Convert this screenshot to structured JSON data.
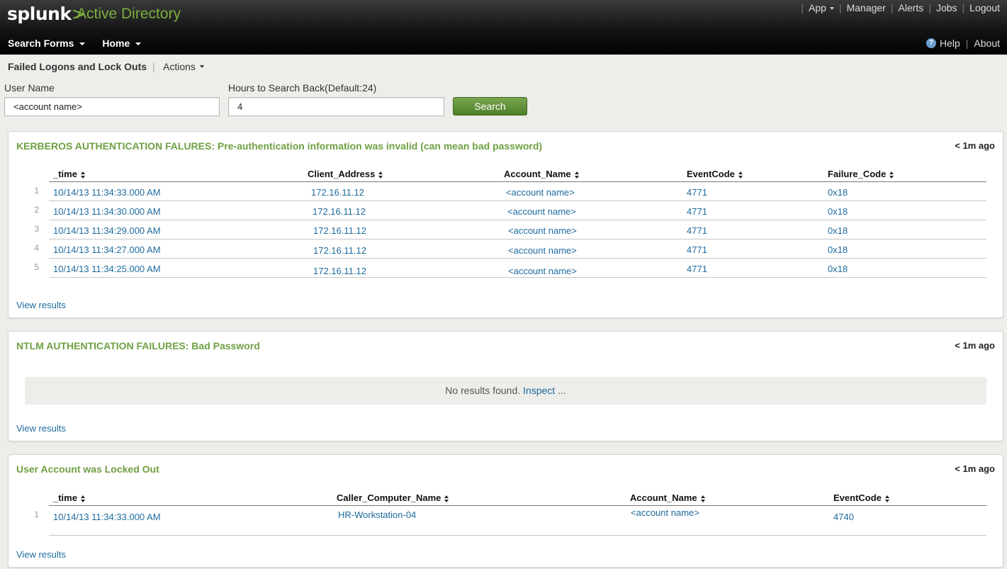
{
  "header": {
    "logo_text": "splunk",
    "logo_mark": ">",
    "app_name": "Active Directory",
    "top_links": [
      "App",
      "Manager",
      "Alerts",
      "Jobs",
      "Logout"
    ],
    "nav": [
      {
        "label": "Search Forms"
      },
      {
        "label": "Home"
      }
    ],
    "help_label": "Help",
    "about_label": "About"
  },
  "view": {
    "title": "Failed Logons and Lock Outs",
    "separator": "|",
    "actions_label": "Actions"
  },
  "form": {
    "user_label": "User Name",
    "user_value": "<account name>",
    "hours_label": "Hours to Search Back(Default:24)",
    "hours_value": "4",
    "search_label": "Search"
  },
  "panels": {
    "kerberos": {
      "title": "KERBEROS AUTHENTICATION FALURES: Pre-authentication information was invalid (can mean bad password)",
      "age": "< 1m ago",
      "columns": [
        "_time",
        "Client_Address",
        "Account_Name",
        "EventCode",
        "Failure_Code"
      ],
      "rows": [
        {
          "n": "1",
          "time": "10/14/13 11:34:33.000 AM",
          "client": "172.16.11.12",
          "account": "<account name>",
          "code": "4771",
          "failure": "0x18"
        },
        {
          "n": "2",
          "time": "10/14/13 11:34:30.000 AM",
          "client": "172.16.11.12",
          "account": "<account name>",
          "code": "4771",
          "failure": "0x18"
        },
        {
          "n": "3",
          "time": "10/14/13 11:34:29.000 AM",
          "client": "172.16.11.12",
          "account": "<account name>",
          "code": "4771",
          "failure": "0x18"
        },
        {
          "n": "4",
          "time": "10/14/13 11:34:27.000 AM",
          "client": "172.16.11.12",
          "account": "<account name>",
          "code": "4771",
          "failure": "0x18"
        },
        {
          "n": "5",
          "time": "10/14/13 11:34:25.000 AM",
          "client": "172.16.11.12",
          "account": "<account name>",
          "code": "4771",
          "failure": "0x18"
        }
      ],
      "view_results": "View results"
    },
    "ntlm": {
      "title": "NTLM AUTHENTICATION FAILURES: Bad Password",
      "age": "< 1m ago",
      "no_results": "No results found.",
      "inspect": "Inspect",
      "ellipsis": "...",
      "view_results": "View results"
    },
    "lockout": {
      "title": "User Account was Locked Out",
      "age": "< 1m ago",
      "columns": [
        "_time",
        "Caller_Computer_Name",
        "Account_Name",
        "EventCode"
      ],
      "rows": [
        {
          "n": "1",
          "time": "10/14/13 11:34:33.000 AM",
          "computer": "HR-Workstation-04",
          "account": "<account name>",
          "code": "4740"
        }
      ],
      "view_results": "View results"
    }
  }
}
